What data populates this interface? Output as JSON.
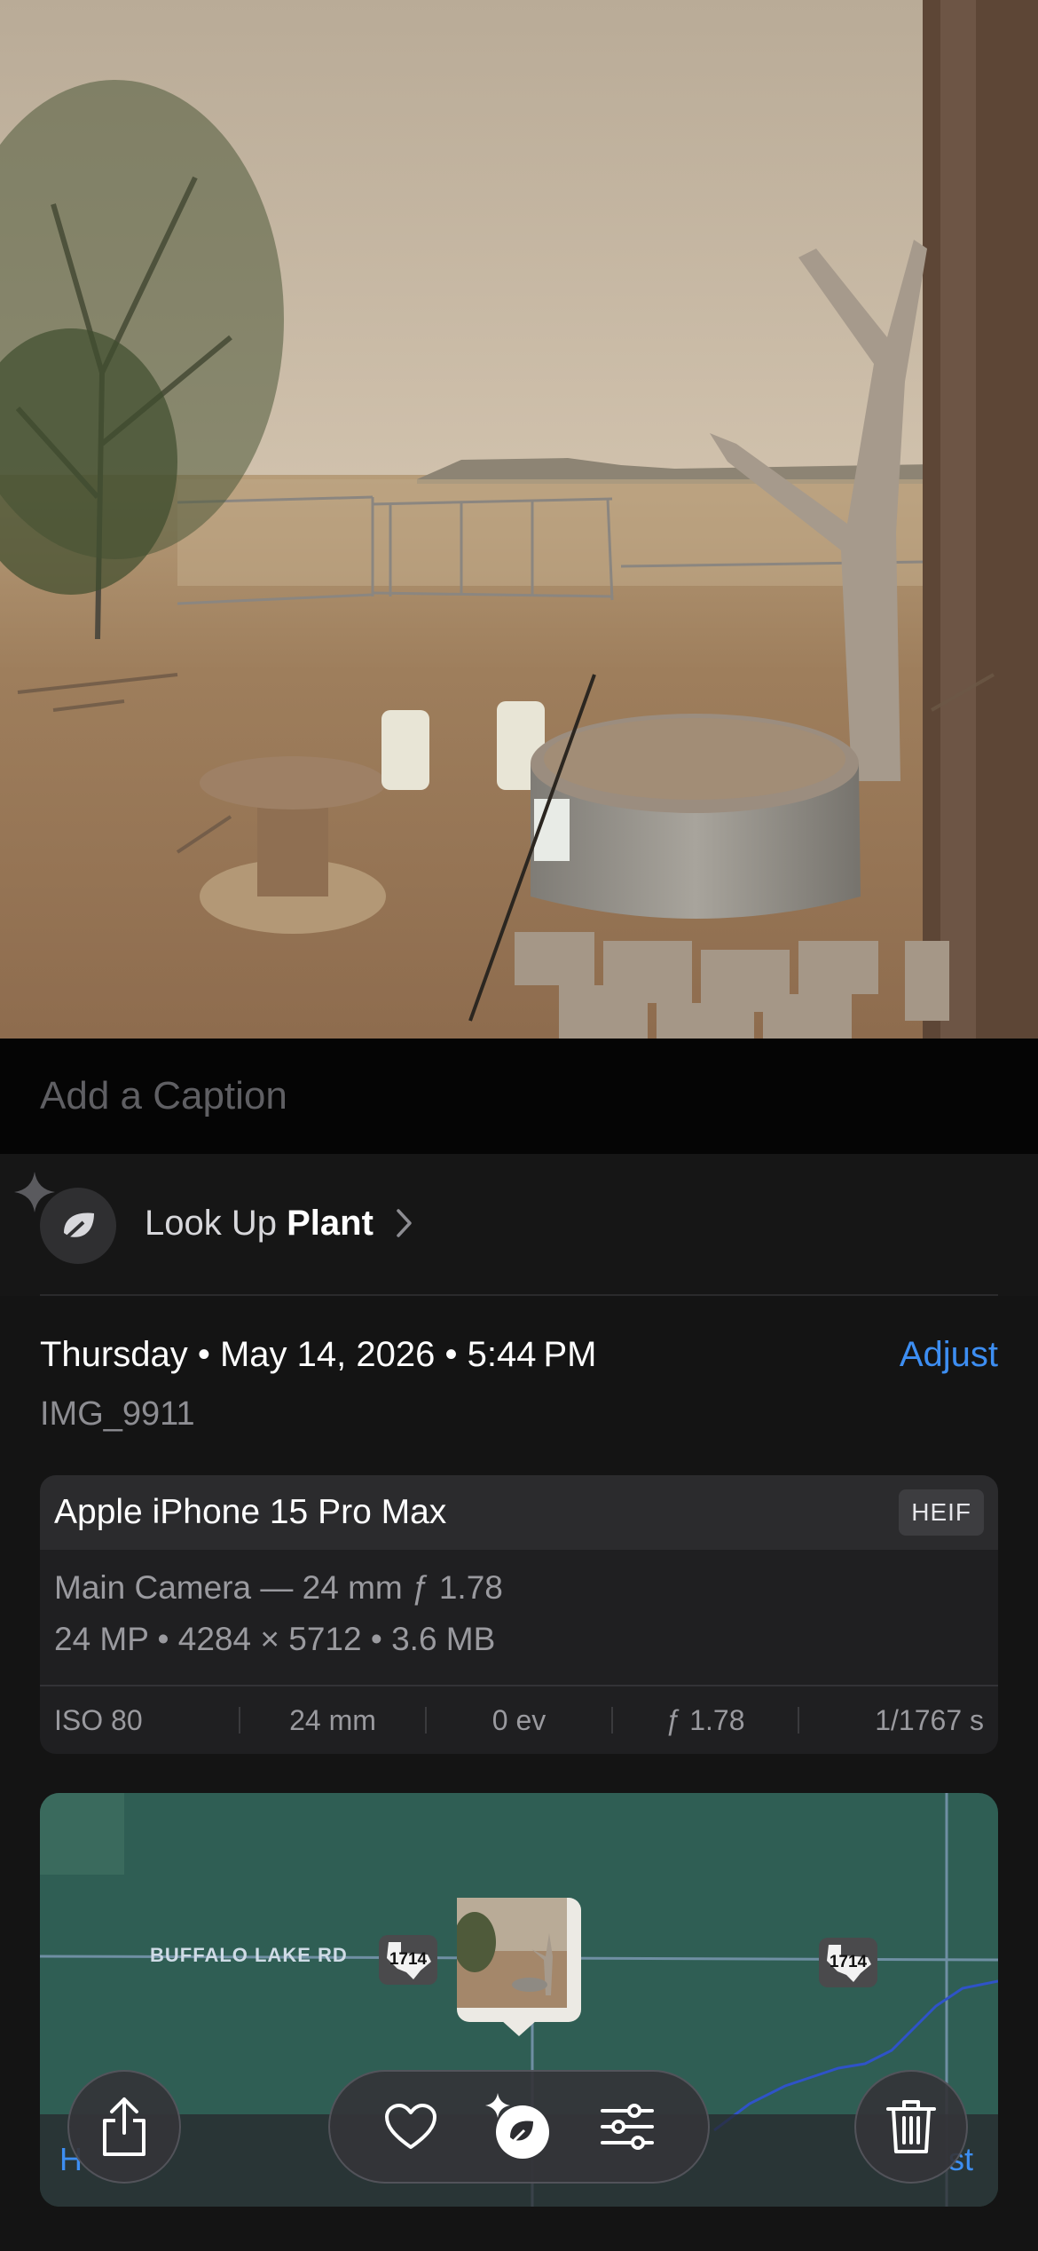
{
  "caption": {
    "placeholder": "Add a Caption"
  },
  "lookup": {
    "prefix": "Look Up",
    "subject": "Plant",
    "icon": "leaf-sparkle-icon"
  },
  "date": {
    "line": "Thursday • May 14, 2026 • 5:44 PM",
    "adjust_label": "Adjust",
    "filename": "IMG_9911"
  },
  "exif": {
    "device": "Apple iPhone 15 Pro Max",
    "format": "HEIF",
    "lens": "Main Camera — 24 mm ƒ 1.78",
    "specs": "24 MP • 4284 × 5712 • 3.6 MB",
    "iso": "ISO 80",
    "focal": "24 mm",
    "ev": "0 ev",
    "aperture": "ƒ 1.78",
    "shutter": "1/1767 s"
  },
  "map": {
    "road_label": "BUFFALO LAKE RD",
    "highway_number": "1714",
    "left_link": "H",
    "right_link": "st",
    "colors": {
      "land": "#2f5e54",
      "road": "#6f8fa3",
      "path": "#2f53c8"
    }
  },
  "toolbar": {
    "share": "share-icon",
    "favorite": "heart-icon",
    "visual_lookup": "leaf-sparkle-icon",
    "edit": "sliders-icon",
    "delete": "trash-icon"
  }
}
